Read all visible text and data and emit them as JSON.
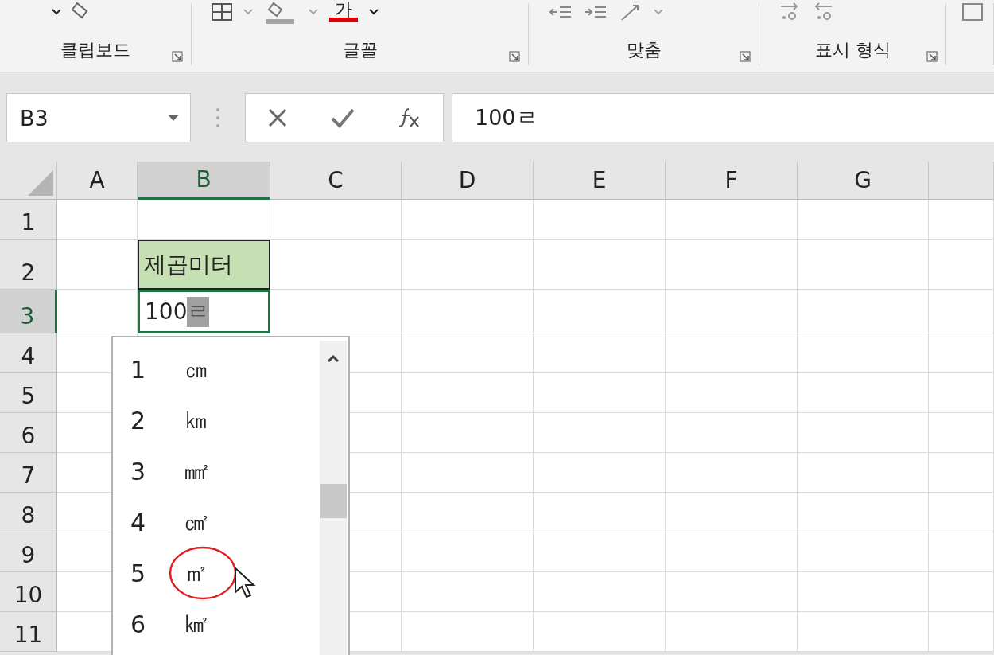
{
  "ribbon": {
    "font_color_glyph": "가",
    "groups": [
      {
        "label": "클립보드",
        "launcher": true
      },
      {
        "label": "글꼴",
        "launcher": true
      },
      {
        "label": "맞춤",
        "launcher": true
      },
      {
        "label": "표시 형식",
        "launcher": true
      }
    ]
  },
  "name_box": {
    "value": "B3"
  },
  "formula_bar": {
    "value": "100ㄹ"
  },
  "columns": [
    {
      "label": "A",
      "selected": false
    },
    {
      "label": "B",
      "selected": true
    },
    {
      "label": "C",
      "selected": false
    },
    {
      "label": "D",
      "selected": false
    },
    {
      "label": "E",
      "selected": false
    },
    {
      "label": "F",
      "selected": false
    },
    {
      "label": "G",
      "selected": false
    }
  ],
  "rows": [
    {
      "label": "1",
      "selected": false
    },
    {
      "label": "2",
      "selected": false,
      "column_b": {
        "kind": "header",
        "text": "제곱미터"
      }
    },
    {
      "label": "3",
      "selected": true,
      "column_b": {
        "kind": "editing",
        "text": "100",
        "composing": "ㄹ"
      }
    },
    {
      "label": "4",
      "selected": false
    },
    {
      "label": "5",
      "selected": false
    },
    {
      "label": "6",
      "selected": false
    },
    {
      "label": "7",
      "selected": false
    },
    {
      "label": "8",
      "selected": false
    },
    {
      "label": "9",
      "selected": false
    },
    {
      "label": "10",
      "selected": false
    },
    {
      "label": "11",
      "selected": false
    }
  ],
  "autocomplete": {
    "items": [
      {
        "number": "1",
        "unit": "㎝",
        "circled": false
      },
      {
        "number": "2",
        "unit": "㎞",
        "circled": false
      },
      {
        "number": "3",
        "unit": "㎟",
        "circled": false
      },
      {
        "number": "4",
        "unit": "㎠",
        "circled": false
      },
      {
        "number": "5",
        "unit": "㎡",
        "circled": true
      },
      {
        "number": "6",
        "unit": "㎢",
        "circled": false
      }
    ]
  }
}
